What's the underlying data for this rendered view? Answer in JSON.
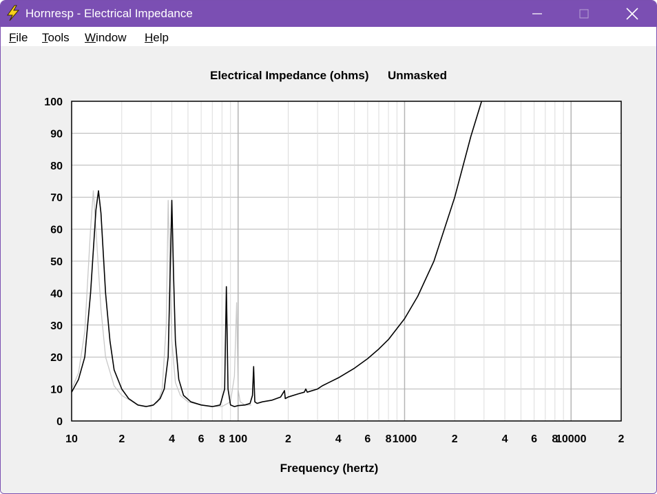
{
  "window": {
    "title": "Hornresp - Electrical Impedance",
    "controls": {
      "minimize": "minimize",
      "maximize": "maximize",
      "close": "close"
    }
  },
  "menu": {
    "items": [
      {
        "label": "File",
        "ul": "F",
        "rest": "ile"
      },
      {
        "label": "Tools",
        "ul": "T",
        "rest": "ools"
      },
      {
        "label": "Window",
        "ul": "W",
        "rest": "indow"
      },
      {
        "label": "Help",
        "ul": "H",
        "rest": "elp"
      }
    ]
  },
  "chart_data": {
    "type": "line",
    "title": "Electrical Impedance (ohms)",
    "subtitle": "Unmasked",
    "xlabel": "Frequency (hertz)",
    "ylabel": "",
    "x_scale": "log",
    "xlim": [
      10,
      20000
    ],
    "ylim": [
      0,
      100
    ],
    "x_tick_labels": [
      {
        "f": 10,
        "t": "10"
      },
      {
        "f": 20,
        "t": "2"
      },
      {
        "f": 40,
        "t": "4"
      },
      {
        "f": 60,
        "t": "6"
      },
      {
        "f": 80,
        "t": "8"
      },
      {
        "f": 100,
        "t": "100"
      },
      {
        "f": 200,
        "t": "2"
      },
      {
        "f": 400,
        "t": "4"
      },
      {
        "f": 600,
        "t": "6"
      },
      {
        "f": 800,
        "t": "8"
      },
      {
        "f": 1000,
        "t": "1000"
      },
      {
        "f": 2000,
        "t": "2"
      },
      {
        "f": 4000,
        "t": "4"
      },
      {
        "f": 6000,
        "t": "6"
      },
      {
        "f": 8000,
        "t": "8"
      },
      {
        "f": 10000,
        "t": "10000"
      },
      {
        "f": 20000,
        "t": "2"
      }
    ],
    "y_ticks": [
      0,
      10,
      20,
      30,
      40,
      50,
      60,
      70,
      80,
      90,
      100
    ],
    "grid": true,
    "colors": {
      "current": "#000000",
      "previous": "#c8c8c8"
    },
    "series": [
      {
        "values_x": [
          10,
          11,
          12,
          13,
          14,
          14.5,
          15,
          16,
          17,
          18,
          20,
          22,
          25,
          28,
          31,
          34,
          36,
          38,
          39,
          40,
          41,
          42,
          44,
          47,
          52,
          60,
          70,
          78,
          83,
          85,
          87,
          90,
          95,
          100,
          110,
          118,
          122,
          124,
          126,
          130,
          140,
          160,
          180,
          190,
          192,
          200,
          230,
          250,
          255,
          260,
          300,
          320,
          350,
          400,
          500,
          600,
          700,
          800,
          1000,
          1200,
          1500,
          2000,
          2500,
          2900
        ],
        "values_y": [
          9,
          13,
          20,
          40,
          66,
          72,
          65,
          40,
          25,
          16,
          10,
          7,
          5,
          4.5,
          5,
          7,
          10,
          20,
          45,
          69,
          45,
          25,
          13,
          8,
          6,
          5,
          4.5,
          5,
          10,
          42,
          10,
          5,
          4.5,
          4.8,
          5,
          5.5,
          8,
          17,
          6,
          5.5,
          6,
          6.5,
          7.5,
          9.5,
          7,
          7.5,
          8.5,
          9,
          10,
          9,
          10,
          11,
          12,
          13.5,
          16.5,
          19.5,
          22.5,
          25.5,
          32,
          39,
          50,
          70,
          89,
          100
        ]
      },
      {
        "values_x": [
          10,
          11,
          12,
          13,
          13.5,
          14,
          15,
          16,
          18,
          20,
          25,
          30,
          33,
          35,
          37,
          38,
          39,
          40,
          42,
          45,
          50,
          60,
          70,
          80,
          90,
          95,
          98,
          100,
          103,
          110,
          120
        ],
        "values_y": [
          10,
          15,
          28,
          60,
          72,
          60,
          35,
          20,
          11,
          8,
          5,
          4.5,
          6,
          10,
          30,
          69,
          45,
          25,
          12,
          8,
          6,
          5,
          4.5,
          4.5,
          6,
          14,
          37,
          10,
          6,
          5,
          5
        ]
      }
    ]
  }
}
